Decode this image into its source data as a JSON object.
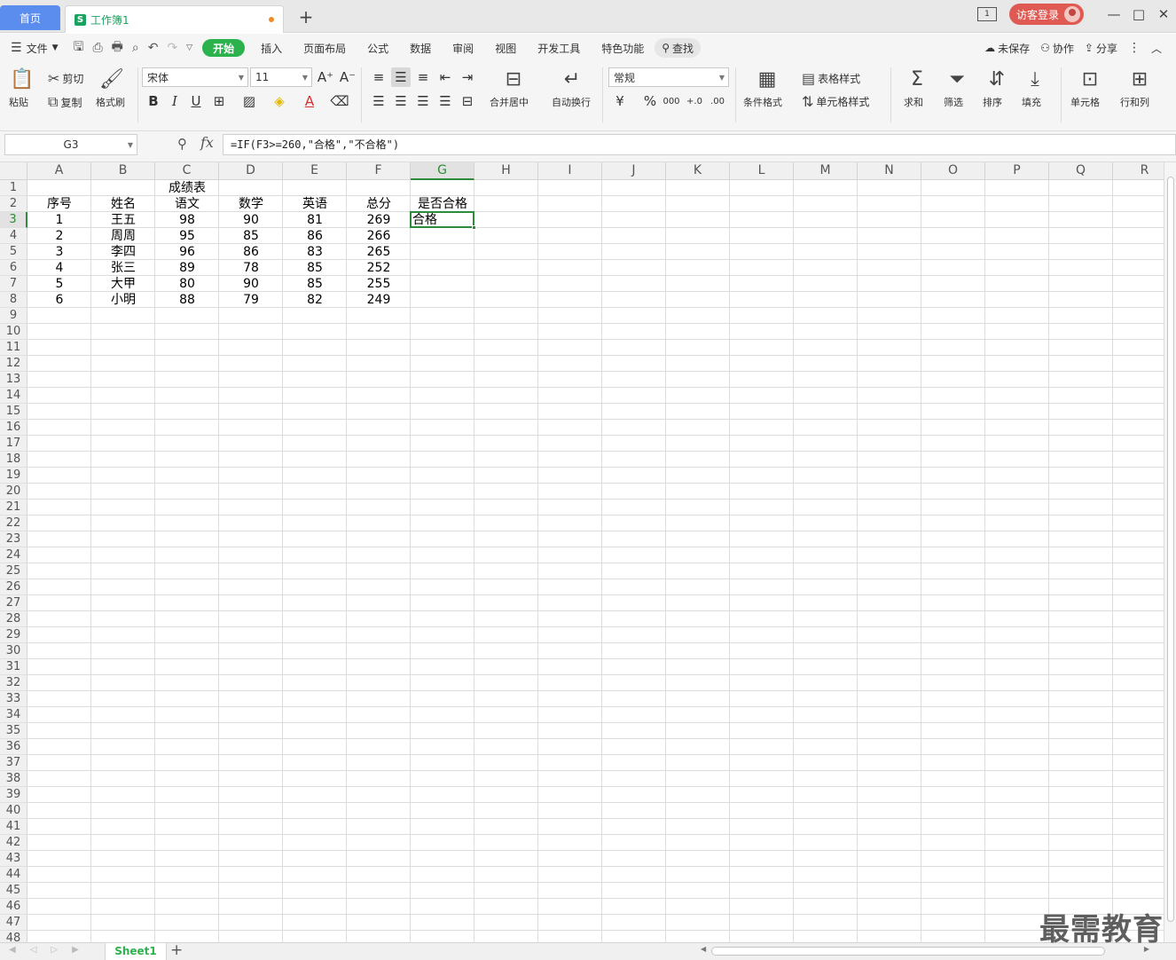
{
  "tabs": {
    "home": "首页",
    "document": "工作簿1",
    "add": "+"
  },
  "window": {
    "screen_badge": "1",
    "login": "访客登录",
    "minimize": "—",
    "maximize": "□",
    "close": "✕"
  },
  "menu": {
    "file": "文件",
    "items": [
      "开始",
      "插入",
      "页面布局",
      "公式",
      "数据",
      "审阅",
      "视图",
      "开发工具",
      "特色功能"
    ],
    "search": "查找",
    "unsaved": "未保存",
    "collab": "协作",
    "share": "分享"
  },
  "ribbon": {
    "paste": "粘贴",
    "cut": "剪切",
    "copy": "复制",
    "format_painter": "格式刷",
    "font_name": "宋体",
    "font_size": "11",
    "merge_center": "合并居中",
    "wrap_text": "自动换行",
    "number_format": "常规",
    "cond_format": "条件格式",
    "table_style": "表格样式",
    "cell_style": "单元格样式",
    "sum": "求和",
    "filter": "筛选",
    "sort": "排序",
    "fill": "填充",
    "cells": "单元格",
    "row_col": "行和列",
    "currency_symbol": "¥",
    "percent": "%",
    "thousands": "000",
    "dec_inc": "+.0",
    "dec_dec": ".00"
  },
  "formula_bar": {
    "name_box": "G3",
    "fx": "fx",
    "formula": "=IF(F3>=260,\"合格\",\"不合格\")"
  },
  "grid": {
    "columns": [
      "A",
      "B",
      "C",
      "D",
      "E",
      "F",
      "G",
      "H",
      "I",
      "J",
      "K",
      "L",
      "M",
      "N",
      "O",
      "P",
      "Q",
      "R"
    ],
    "selected_column": "G",
    "selected_row": 3,
    "title_cell": "成绩表",
    "headers": [
      "序号",
      "姓名",
      "语文",
      "数学",
      "英语",
      "总分",
      "是否合格"
    ],
    "rows": [
      [
        "1",
        "王五",
        "98",
        "90",
        "81",
        "269",
        "合格"
      ],
      [
        "2",
        "周周",
        "95",
        "85",
        "86",
        "266",
        ""
      ],
      [
        "3",
        "李四",
        "96",
        "86",
        "83",
        "265",
        ""
      ],
      [
        "4",
        "张三",
        "89",
        "78",
        "85",
        "252",
        ""
      ],
      [
        "5",
        "大甲",
        "80",
        "90",
        "85",
        "255",
        ""
      ],
      [
        "6",
        "小明",
        "88",
        "79",
        "82",
        "249",
        ""
      ]
    ],
    "row_count": 48
  },
  "sheets": {
    "active": "Sheet1",
    "add": "+"
  },
  "watermark": "最需教育"
}
